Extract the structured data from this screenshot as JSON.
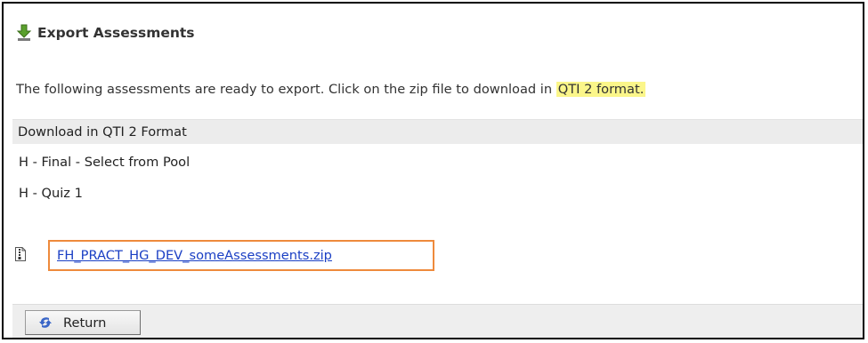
{
  "page": {
    "title": "Export Assessments",
    "title_icon": "download-arrow-icon"
  },
  "intro": {
    "text": "The following assessments are ready to export. Click on the zip file to download in ",
    "highlight": "QTI 2 format."
  },
  "list": {
    "header": "Download in QTI 2 Format",
    "items": [
      "H - Final - Select from Pool",
      "H - Quiz 1"
    ]
  },
  "download": {
    "file_icon": "document-icon",
    "filename": "FH_PRACT_HG_DEV_someAssessments.zip"
  },
  "footer": {
    "return_label": "Return",
    "return_icon": "return-arrow-icon"
  },
  "colors": {
    "highlight": "#fbf68a",
    "link": "#1a3fc4",
    "focus_outline": "#ee8a3c",
    "bar_background": "#ececec"
  }
}
